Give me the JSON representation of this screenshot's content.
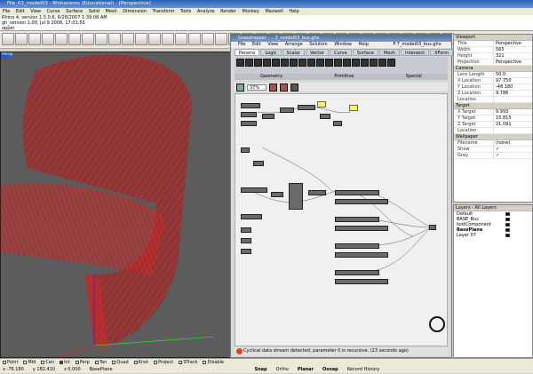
{
  "window": {
    "title": "File_03_model03 - Rhinoceros (Educational) - [Perspective]"
  },
  "menu": [
    "File",
    "Edit",
    "View",
    "Curve",
    "Surface",
    "Solid",
    "Mesh",
    "Dimension",
    "Transform",
    "Tools",
    "Analyze",
    "Render",
    "Monkey",
    "Maxwell",
    "Help"
  ],
  "command_history": [
    "Rhino 4, version 1.5.0.6, 6/28/2007 1:39:08 AM",
    "gh_version 1.00, Jul 9 2008, 17:01:55",
    "opper"
  ],
  "viewport": {
    "label": "Persp"
  },
  "grasshopper": {
    "title": "Grasshopper - ...3_model03_bus.ghx",
    "file_label": "F:7_model03_bus.ghx",
    "menu": [
      "File",
      "Edit",
      "View",
      "Arrange",
      "Solution",
      "Window",
      "Help"
    ],
    "tabs": [
      "Params",
      "Logic",
      "Scalar",
      "Vector",
      "Curve",
      "Surface",
      "Mesh",
      "Intersect",
      "XForm"
    ],
    "active_tab": "Params",
    "categories": [
      "Geometry",
      "Primitive",
      "Special"
    ],
    "zoom": "37%",
    "status": "Cyclical data stream detected, parameter 0 is recursive. (23 seconds ago)"
  },
  "properties": {
    "section_viewport": "Viewport",
    "section_camera": "Camera",
    "section_target": "Target",
    "section_wallpaper": "Wallpaper",
    "viewport_rows": [
      {
        "k": "Title",
        "v": "Perspective"
      },
      {
        "k": "Width",
        "v": "565"
      },
      {
        "k": "Height",
        "v": "321"
      },
      {
        "k": "Projection",
        "v": "Perspective"
      }
    ],
    "camera_rows": [
      {
        "k": "Lens Length",
        "v": "50.0"
      },
      {
        "k": "X Location",
        "v": "97.750"
      },
      {
        "k": "Y Location",
        "v": "-48.180"
      },
      {
        "k": "Z Location",
        "v": "9.786"
      },
      {
        "k": "Location",
        "v": ""
      }
    ],
    "target_rows": [
      {
        "k": "X Target",
        "v": "9.993"
      },
      {
        "k": "Y Target",
        "v": "15.815"
      },
      {
        "k": "Z Target",
        "v": "21.091"
      },
      {
        "k": "Location",
        "v": ""
      }
    ],
    "wallpaper_rows": [
      {
        "k": "Filename",
        "v": "(none)"
      },
      {
        "k": "Show",
        "v": "✓"
      },
      {
        "k": "Gray",
        "v": "✓"
      }
    ]
  },
  "layers": {
    "header": "Layers - All Layers",
    "items": [
      {
        "name": "Default",
        "color": "#000000"
      },
      {
        "name": "BASE_Bus",
        "color": "#000000"
      },
      {
        "name": "textComponent",
        "color": "#000000"
      },
      {
        "name": "BasePlane",
        "color": "#000000"
      },
      {
        "name": "Layer 07",
        "color": "#000000"
      }
    ],
    "current": "BasePlane"
  },
  "osnap": [
    {
      "label": "Point",
      "on": false
    },
    {
      "label": "Mid",
      "on": false
    },
    {
      "label": "Cen",
      "on": false
    },
    {
      "label": "Int",
      "on": true
    },
    {
      "label": "Perp",
      "on": false
    },
    {
      "label": "Tan",
      "on": false
    },
    {
      "label": "Quad",
      "on": false
    },
    {
      "label": "Knot",
      "on": false
    },
    {
      "label": "Project",
      "on": false
    },
    {
      "label": "STrack",
      "on": false
    },
    {
      "label": "Disable",
      "on": false
    }
  ],
  "coords": {
    "x": "x -76.180",
    "y": "y 182.410",
    "z": "z 0.000",
    "layer": "BasePlane",
    "snap": "Snap",
    "ortho": "Ortho",
    "planar": "Planar",
    "osnap": "Osnap",
    "record_history": "Record History"
  },
  "colors": {
    "geometry": "#c41616",
    "viewport_bg": "#5c5c5c",
    "gh_panel": "#fff35a",
    "title_blue": "#2d5fb2"
  }
}
